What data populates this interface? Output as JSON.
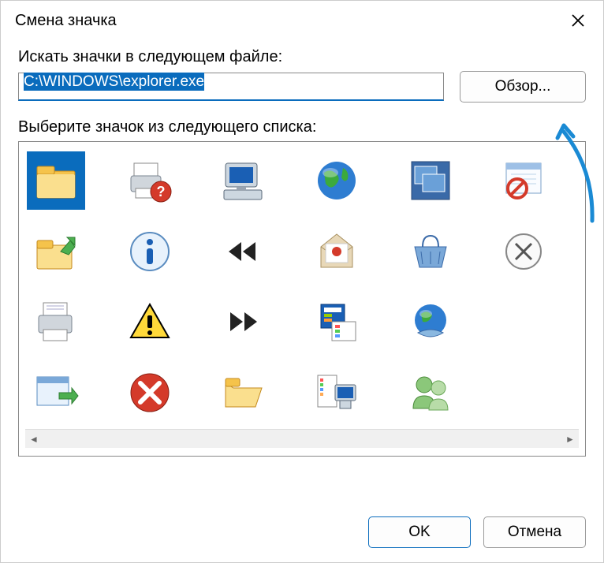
{
  "dialog": {
    "title": "Смена значка",
    "label_search": "Искать значки в следующем файле:",
    "path_value": "C:\\WINDOWS\\explorer.exe",
    "browse_label": "Обзор...",
    "label_select": "Выберите значок из следующего списка:",
    "ok_label": "OK",
    "cancel_label": "Отмена"
  },
  "icons": [
    {
      "name": "folder-icon",
      "selected": true
    },
    {
      "name": "printer-help-icon",
      "selected": false
    },
    {
      "name": "computer-monitor-icon",
      "selected": false
    },
    {
      "name": "globe-icon",
      "selected": false
    },
    {
      "name": "windows-cascade-icon",
      "selected": false
    },
    {
      "name": "window-blocked-icon",
      "selected": false
    },
    {
      "name": "folder-up-icon",
      "selected": false
    },
    {
      "name": "info-icon",
      "selected": false
    },
    {
      "name": "rewind-icon",
      "selected": false
    },
    {
      "name": "mail-open-icon",
      "selected": false
    },
    {
      "name": "basket-icon",
      "selected": false
    },
    {
      "name": "close-circle-icon",
      "selected": false
    },
    {
      "name": "printer-icon",
      "selected": false
    },
    {
      "name": "warning-icon",
      "selected": false
    },
    {
      "name": "forward-icon",
      "selected": false
    },
    {
      "name": "document-options-icon",
      "selected": false
    },
    {
      "name": "globe-network-icon",
      "selected": false
    },
    {
      "name": "empty-slot-1",
      "selected": false
    },
    {
      "name": "eject-window-icon",
      "selected": false
    },
    {
      "name": "error-icon",
      "selected": false
    },
    {
      "name": "folder-open-icon",
      "selected": false
    },
    {
      "name": "computer-list-icon",
      "selected": false
    },
    {
      "name": "users-icon",
      "selected": false
    },
    {
      "name": "empty-slot-2",
      "selected": false
    }
  ],
  "colors": {
    "accent": "#0a6cbd"
  }
}
